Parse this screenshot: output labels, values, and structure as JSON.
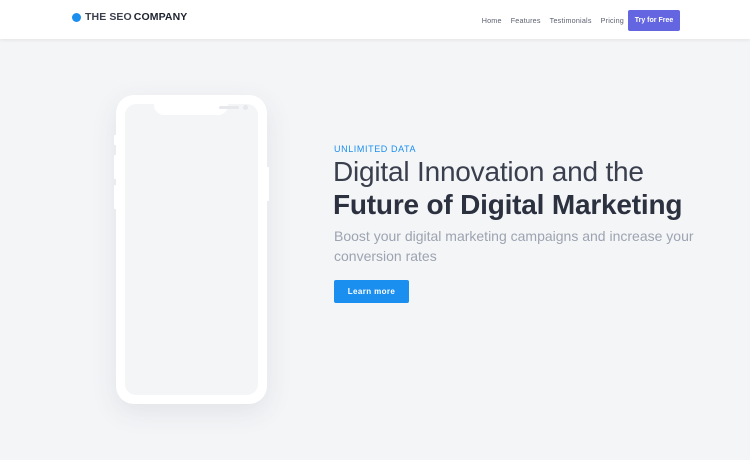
{
  "header": {
    "logo": {
      "light": "THE SEO",
      "bold": "COMPANY"
    },
    "nav": [
      "Home",
      "Features",
      "Testimonials",
      "Pricing"
    ],
    "cta_label": "Try for Free"
  },
  "hero": {
    "eyebrow": "UNLIMITED DATA",
    "title_light": "Digital Innovation and the",
    "title_bold": "Future of Digital Marketing",
    "subtitle": "Boost your digital marketing campaigns and increase your conversion rates",
    "button_label": "Learn more"
  },
  "colors": {
    "accent": "#1a8ff0",
    "cta": "#6366e0",
    "background": "#f4f5f7"
  },
  "icons": {
    "logo": "circle-dot-icon"
  }
}
